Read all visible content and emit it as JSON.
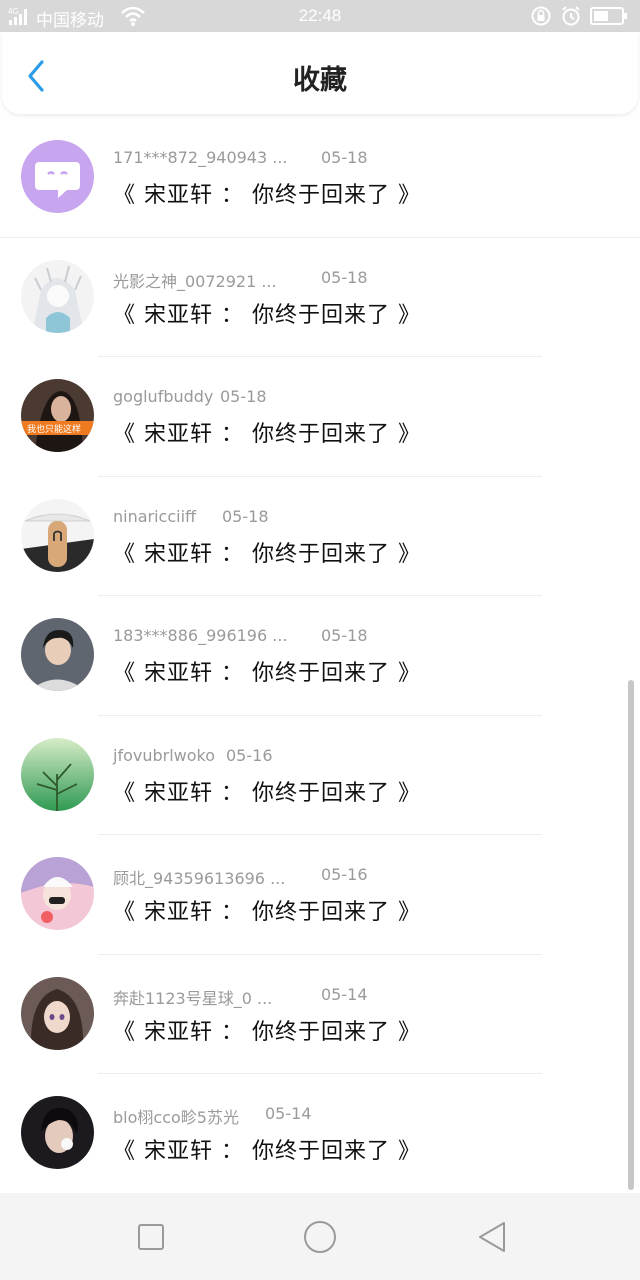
{
  "status_bar": {
    "signal": "4G",
    "carrier": "中国移动",
    "time": "22:48",
    "icons": [
      "lock-rotation-icon",
      "alarm-icon",
      "battery-icon"
    ]
  },
  "header": {
    "title": "收藏",
    "back_icon": "chevron-left-icon",
    "accent_color": "#2a9be8"
  },
  "favorites": [
    {
      "user": "171***872_940943 ...",
      "date": "05-18",
      "message": "《 宋亚轩 ： 你终于回来了 》",
      "avatar": "chat-bubble-avatar"
    },
    {
      "user": "光影之神_0072921 ...",
      "date": "05-18",
      "message": "《 宋亚轩 ： 你终于回来了 》",
      "avatar": "anime-character-avatar"
    },
    {
      "user": "goglufbuddy",
      "date": "05-18",
      "message": "《 宋亚轩 ： 你终于回来了 》",
      "avatar": "girl-photo-avatar",
      "avatar_caption": "我也只能这样"
    },
    {
      "user": "ninaricciiff",
      "date": "05-18",
      "message": "《 宋亚轩 ： 你终于回来了 》",
      "avatar": "finger-avatar"
    },
    {
      "user": "183***886_996196 ...",
      "date": "05-18",
      "message": "《 宋亚轩 ： 你终于回来了 》",
      "avatar": "boy-photo-avatar"
    },
    {
      "user": "jfovubrlwoko",
      "date": "05-16",
      "message": "《 宋亚轩 ： 你终于回来了 》",
      "avatar": "green-tree-avatar"
    },
    {
      "user": "顾北_943596136​96 ...",
      "date": "05-16",
      "message": "《 宋亚轩 ： 你终于回来了 》",
      "avatar": "pink-anime-avatar"
    },
    {
      "user": "奔赴1123号星球_0 ...",
      "date": "05-14",
      "message": "《 宋亚轩 ： 你终于回来了 》",
      "avatar": "anime-girl-avatar"
    },
    {
      "user": "blo栩cco畛5苏光",
      "date": "05-14",
      "message": "《 宋亚轩 ： 你终于回来了 》",
      "avatar": "portrait-avatar"
    }
  ],
  "nav_bar": {
    "buttons": [
      "recent-apps-icon",
      "home-icon",
      "back-triangle-icon"
    ]
  }
}
